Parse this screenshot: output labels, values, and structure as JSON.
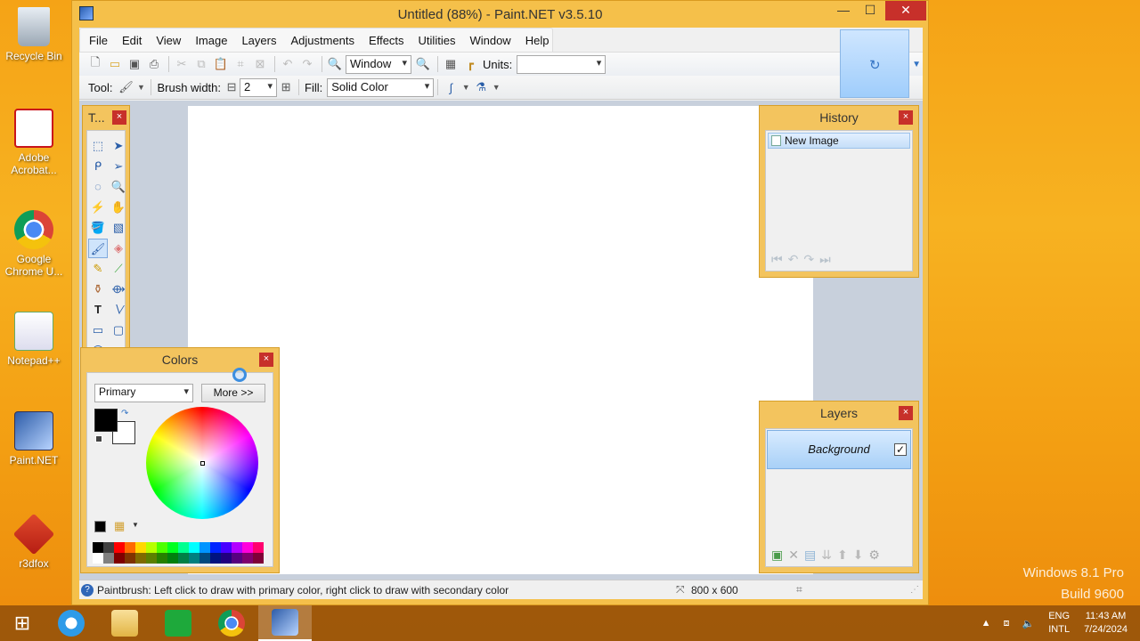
{
  "desktop": {
    "icons": [
      {
        "label": "Recycle Bin"
      },
      {
        "label": "Adobe Acrobat..."
      },
      {
        "label": "Google Chrome U..."
      },
      {
        "label": "Notepad++"
      },
      {
        "label": "Paint.NET"
      },
      {
        "label": "r3dfox"
      }
    ],
    "watermark_line1": "Windows 8.1 Pro",
    "watermark_line2": "Build 9600"
  },
  "window": {
    "title": "Untitled (88%) - Paint.NET v3.5.10",
    "minimize": "—",
    "maximize": "☐",
    "close": "✕"
  },
  "menu": [
    "File",
    "Edit",
    "View",
    "Image",
    "Layers",
    "Adjustments",
    "Effects",
    "Utilities",
    "Window",
    "Help"
  ],
  "toolbar": {
    "zoom_value": "Window",
    "units_label": "Units:",
    "units_value": "",
    "tool_label": "Tool:",
    "brush_width_label": "Brush width:",
    "brush_width_value": "2",
    "fill_label": "Fill:",
    "fill_value": "Solid Color"
  },
  "tools_panel": {
    "title": "T...",
    "close": "×"
  },
  "history_panel": {
    "title": "History",
    "close": "×",
    "items": [
      "New Image"
    ]
  },
  "layers_panel": {
    "title": "Layers",
    "close": "×",
    "layers": [
      {
        "name": "Background",
        "visible": true,
        "check": "✓"
      }
    ]
  },
  "colors_panel": {
    "title": "Colors",
    "close": "×",
    "mode": "Primary",
    "more_button": "More >>",
    "primary_color": "#000000",
    "secondary_color": "#ffffff"
  },
  "status": {
    "message": "Paintbrush: Left click to draw with primary color, right click to draw with secondary color",
    "image_size": "800 x 600"
  },
  "taskbar": {
    "language_line1": "ENG",
    "language_line2": "INTL",
    "time": "11:43 AM",
    "date": "7/24/2024"
  }
}
